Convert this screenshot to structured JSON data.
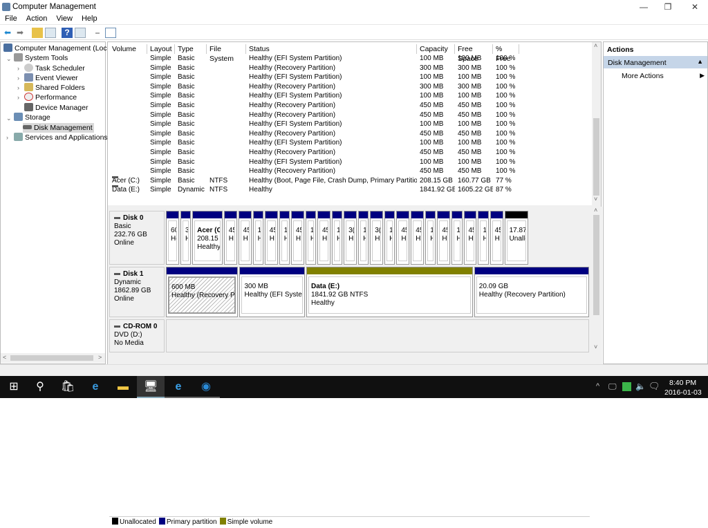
{
  "window": {
    "title": "Computer Management",
    "minimize": "—",
    "maximize": "❐",
    "close": "✕"
  },
  "menu": [
    "File",
    "Action",
    "View",
    "Help"
  ],
  "toolbar": {
    "icons": [
      "back-arrow-icon",
      "forward-arrow-icon",
      "up-folder-icon",
      "show-hide-tree-icon",
      "help-icon",
      "show-hide-action-pane-icon",
      "connect-icon",
      "properties-icon"
    ]
  },
  "tree": {
    "root": "Computer Management (Local",
    "system_tools": "System Tools",
    "task_scheduler": "Task Scheduler",
    "event_viewer": "Event Viewer",
    "shared_folders": "Shared Folders",
    "performance": "Performance",
    "device_manager": "Device Manager",
    "storage": "Storage",
    "disk_management": "Disk Management",
    "services": "Services and Applications"
  },
  "table": {
    "columns": [
      "Volume",
      "Layout",
      "Type",
      "File System",
      "Status",
      "Capacity",
      "Free Space",
      "% Free"
    ],
    "rows": [
      [
        "",
        "Simple",
        "Basic",
        "",
        "Healthy (EFI System Partition)",
        "100 MB",
        "100 MB",
        "100 %"
      ],
      [
        "",
        "Simple",
        "Basic",
        "",
        "Healthy (Recovery Partition)",
        "300 MB",
        "300 MB",
        "100 %"
      ],
      [
        "",
        "Simple",
        "Basic",
        "",
        "Healthy (EFI System Partition)",
        "100 MB",
        "100 MB",
        "100 %"
      ],
      [
        "",
        "Simple",
        "Basic",
        "",
        "Healthy (Recovery Partition)",
        "300 MB",
        "300 MB",
        "100 %"
      ],
      [
        "",
        "Simple",
        "Basic",
        "",
        "Healthy (EFI System Partition)",
        "100 MB",
        "100 MB",
        "100 %"
      ],
      [
        "",
        "Simple",
        "Basic",
        "",
        "Healthy (Recovery Partition)",
        "450 MB",
        "450 MB",
        "100 %"
      ],
      [
        "",
        "Simple",
        "Basic",
        "",
        "Healthy (Recovery Partition)",
        "450 MB",
        "450 MB",
        "100 %"
      ],
      [
        "",
        "Simple",
        "Basic",
        "",
        "Healthy (EFI System Partition)",
        "100 MB",
        "100 MB",
        "100 %"
      ],
      [
        "",
        "Simple",
        "Basic",
        "",
        "Healthy (Recovery Partition)",
        "450 MB",
        "450 MB",
        "100 %"
      ],
      [
        "",
        "Simple",
        "Basic",
        "",
        "Healthy (EFI System Partition)",
        "100 MB",
        "100 MB",
        "100 %"
      ],
      [
        "",
        "Simple",
        "Basic",
        "",
        "Healthy (Recovery Partition)",
        "450 MB",
        "450 MB",
        "100 %"
      ],
      [
        "",
        "Simple",
        "Basic",
        "",
        "Healthy (EFI System Partition)",
        "100 MB",
        "100 MB",
        "100 %"
      ],
      [
        "",
        "Simple",
        "Basic",
        "",
        "Healthy (Recovery Partition)",
        "450 MB",
        "450 MB",
        "100 %"
      ],
      [
        "Acer (C:)",
        "Simple",
        "Basic",
        "NTFS",
        "Healthy (Boot, Page File, Crash Dump, Primary Partition)",
        "208.15 GB",
        "160.77 GB",
        "77 %"
      ],
      [
        "Data (E:)",
        "Simple",
        "Dynamic",
        "NTFS",
        "Healthy",
        "1841.92 GB",
        "1605.22 GB",
        "87 %"
      ]
    ]
  },
  "disks": [
    {
      "name": "Disk 0",
      "type": "Basic",
      "size": "232.76 GB",
      "status": "Online",
      "partitions": [
        {
          "l1": "60",
          "l2": "He",
          "w": 1
        },
        {
          "l1": "3(",
          "l2": "H",
          "w": 0.8
        },
        {
          "l1": "Acer (C:)",
          "l2": "208.15 GB NTFS",
          "l3": "Healthy",
          "w": 2.3,
          "bold": true
        },
        {
          "l1": "45",
          "l2": "H",
          "w": 1
        },
        {
          "l1": "45",
          "l2": "H",
          "w": 1
        },
        {
          "l1": "1",
          "l2": "H",
          "w": 0.8
        },
        {
          "l1": "45",
          "l2": "H",
          "w": 1
        },
        {
          "l1": "1",
          "l2": "H",
          "w": 0.8
        },
        {
          "l1": "45",
          "l2": "H",
          "w": 1
        },
        {
          "l1": "1",
          "l2": "H",
          "w": 0.8
        },
        {
          "l1": "45",
          "l2": "H",
          "w": 1
        },
        {
          "l1": "1",
          "l2": "H",
          "w": 0.8
        },
        {
          "l1": "3(",
          "l2": "H",
          "w": 1
        },
        {
          "l1": "1",
          "l2": "H",
          "w": 0.8
        },
        {
          "l1": "3(",
          "l2": "H",
          "w": 1
        },
        {
          "l1": "1",
          "l2": "H",
          "w": 0.8
        },
        {
          "l1": "45",
          "l2": "H",
          "w": 1
        },
        {
          "l1": "45",
          "l2": "H",
          "w": 1
        },
        {
          "l1": "1",
          "l2": "H",
          "w": 0.8
        },
        {
          "l1": "45",
          "l2": "H",
          "w": 1
        },
        {
          "l1": "1",
          "l2": "H",
          "w": 0.8
        },
        {
          "l1": "45",
          "l2": "H",
          "w": 1
        },
        {
          "l1": "1",
          "l2": "H",
          "w": 0.8
        },
        {
          "l1": "45",
          "l2": "H",
          "w": 1
        },
        {
          "l1": "17.87 GB",
          "l2": "Unallocated",
          "w": 1.8,
          "kind": "unallocated"
        }
      ]
    },
    {
      "name": "Disk 1",
      "type": "Dynamic",
      "size": "1862.89 GB",
      "status": "Online",
      "partitions": [
        {
          "l1": "600 MB",
          "l2": "Healthy (Recovery Partition)",
          "w": 105,
          "selected": true
        },
        {
          "l1": "300 MB",
          "l2": "Healthy (EFI System Partition)",
          "w": 95
        },
        {
          "l1": "Data (E:)",
          "l2": "1841.92 GB NTFS",
          "l3": "Healthy",
          "w": 242,
          "bold": true,
          "kind": "simple"
        },
        {
          "l1": "20.09 GB",
          "l2": "Healthy (Recovery Partition)",
          "w": 167
        }
      ]
    },
    {
      "name": "CD-ROM 0",
      "type": "DVD (D:)",
      "status": "No Media"
    }
  ],
  "legend": [
    {
      "label": "Unallocated",
      "color": "#000000"
    },
    {
      "label": "Primary partition",
      "color": "#000080"
    },
    {
      "label": "Simple volume",
      "color": "#808000"
    }
  ],
  "actions": {
    "header": "Actions",
    "section": "Disk Management",
    "more": "More Actions"
  },
  "taskbar": {
    "time": "8:40 PM",
    "date": "2016-01-03"
  }
}
